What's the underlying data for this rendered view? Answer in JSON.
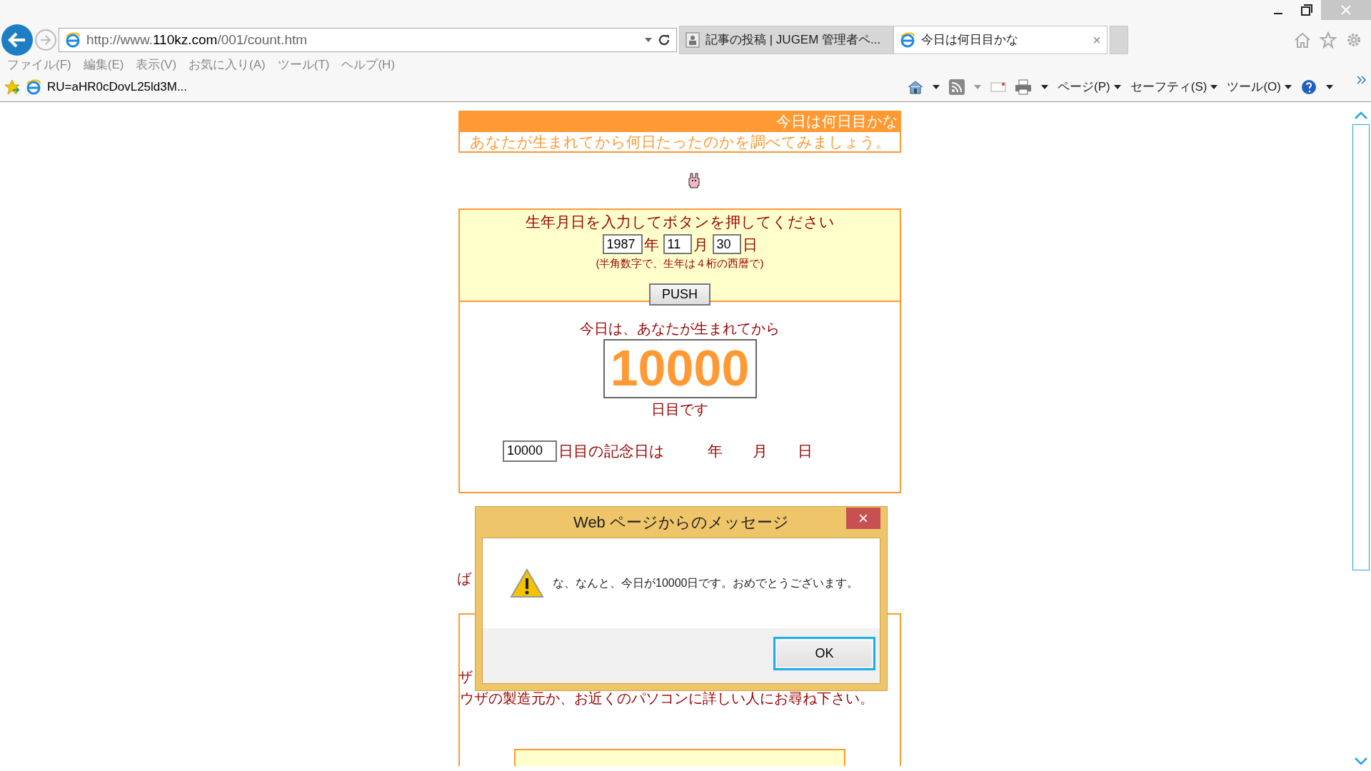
{
  "address_bar": {
    "url_prefix": "http://www.",
    "url_domain": "110kz.com",
    "url_path": "/001/count.htm"
  },
  "tabs": [
    {
      "title": "記事の投稿 | JUGEM 管理者ペ...",
      "selected": false
    },
    {
      "title": "今日は何日目かな",
      "selected": true,
      "close": "×"
    }
  ],
  "menu": [
    "ファイル(F)",
    "編集(E)",
    "表示(V)",
    "お気に入り(A)",
    "ツール(T)",
    "ヘルプ(H)"
  ],
  "favorites_bar": {
    "item": "RU=aHR0cDovL25ld3M..."
  },
  "command_bar": [
    "ページ(P)",
    "セーフティ(S)",
    "ツール(O)"
  ],
  "page": {
    "header_title": "今日は何日目かな",
    "subtitle": "あなたが生まれてから何日たったのかを調べてみましょう。",
    "form": {
      "prompt": "生年月日を入力してボタンを押してください",
      "year": "1987",
      "year_unit": "年",
      "month": "11",
      "month_unit": "月",
      "day": "30",
      "day_unit": "日",
      "note": "(半角数字で、生年は４桁の西暦で)",
      "button": "PUSH"
    },
    "result": {
      "lead": "今日は、あなたが生まれてから",
      "count": "10000",
      "tail": "日目です",
      "anniversary_days": "10000",
      "anniversary_label": "日目の記念日は",
      "year_unit": "年",
      "month_unit": "月",
      "day_unit": "日"
    },
    "behind_fragments": [
      "ば",
      "ザ"
    ],
    "notice_line": "ウザの製造元か、お近くのパソコンに詳しい人にお尋ね下さい。"
  },
  "dialog": {
    "title": "Web ページからのメッセージ",
    "close": "×",
    "message": "な、なんと、今日が10000日です。おめでとうございます。",
    "button": "OK"
  }
}
